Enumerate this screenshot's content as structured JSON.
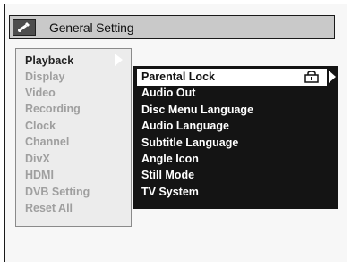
{
  "title": "General Setting",
  "left_menu": [
    {
      "label": "Playback",
      "active": true
    },
    {
      "label": "Display"
    },
    {
      "label": "Video"
    },
    {
      "label": "Recording"
    },
    {
      "label": "Clock"
    },
    {
      "label": "Channel"
    },
    {
      "label": "DivX"
    },
    {
      "label": "HDMI"
    },
    {
      "label": "DVB Setting"
    },
    {
      "label": "Reset All"
    }
  ],
  "right_menu": [
    {
      "label": "Parental Lock",
      "active": true
    },
    {
      "label": "Audio Out"
    },
    {
      "label": "Disc Menu Language"
    },
    {
      "label": "Audio Language"
    },
    {
      "label": "Subtitle Language"
    },
    {
      "label": "Angle Icon"
    },
    {
      "label": "Still Mode"
    },
    {
      "label": "TV System"
    }
  ],
  "icons": {
    "title": "settings-wrench-icon",
    "lock": "lock-icon"
  }
}
